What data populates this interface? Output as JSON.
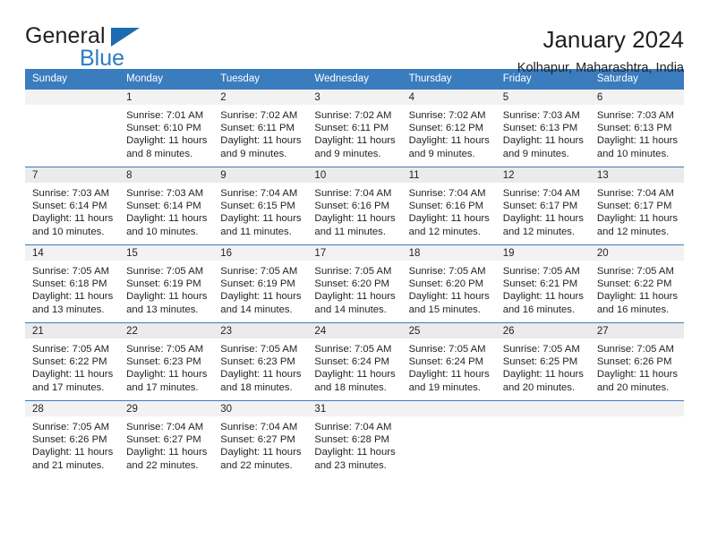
{
  "brand": {
    "word_one": "General",
    "word_two": "Blue",
    "accent_color": "#1b6cb0",
    "blue_text_color": "#2b7cc4"
  },
  "header": {
    "title": "January 2024",
    "subtitle": "Kolhapur, Maharashtra, India"
  },
  "calendar": {
    "header_background": "#3a7cbe",
    "header_text_color": "#ffffff",
    "daynum_band_color": "#f2f2f2",
    "weekday_headers": [
      "Sunday",
      "Monday",
      "Tuesday",
      "Wednesday",
      "Thursday",
      "Friday",
      "Saturday"
    ],
    "labels": {
      "sunrise": "Sunrise:",
      "sunset": "Sunset:",
      "daylight": "Daylight:"
    },
    "weeks": [
      [
        {
          "day": ""
        },
        {
          "day": "1",
          "sunrise": "Sunrise: 7:01 AM",
          "sunset": "Sunset: 6:10 PM",
          "daylight_line1": "Daylight: 11 hours",
          "daylight_line2": "and 8 minutes."
        },
        {
          "day": "2",
          "sunrise": "Sunrise: 7:02 AM",
          "sunset": "Sunset: 6:11 PM",
          "daylight_line1": "Daylight: 11 hours",
          "daylight_line2": "and 9 minutes."
        },
        {
          "day": "3",
          "sunrise": "Sunrise: 7:02 AM",
          "sunset": "Sunset: 6:11 PM",
          "daylight_line1": "Daylight: 11 hours",
          "daylight_line2": "and 9 minutes."
        },
        {
          "day": "4",
          "sunrise": "Sunrise: 7:02 AM",
          "sunset": "Sunset: 6:12 PM",
          "daylight_line1": "Daylight: 11 hours",
          "daylight_line2": "and 9 minutes."
        },
        {
          "day": "5",
          "sunrise": "Sunrise: 7:03 AM",
          "sunset": "Sunset: 6:13 PM",
          "daylight_line1": "Daylight: 11 hours",
          "daylight_line2": "and 9 minutes."
        },
        {
          "day": "6",
          "sunrise": "Sunrise: 7:03 AM",
          "sunset": "Sunset: 6:13 PM",
          "daylight_line1": "Daylight: 11 hours",
          "daylight_line2": "and 10 minutes."
        }
      ],
      [
        {
          "day": "7",
          "sunrise": "Sunrise: 7:03 AM",
          "sunset": "Sunset: 6:14 PM",
          "daylight_line1": "Daylight: 11 hours",
          "daylight_line2": "and 10 minutes."
        },
        {
          "day": "8",
          "sunrise": "Sunrise: 7:03 AM",
          "sunset": "Sunset: 6:14 PM",
          "daylight_line1": "Daylight: 11 hours",
          "daylight_line2": "and 10 minutes."
        },
        {
          "day": "9",
          "sunrise": "Sunrise: 7:04 AM",
          "sunset": "Sunset: 6:15 PM",
          "daylight_line1": "Daylight: 11 hours",
          "daylight_line2": "and 11 minutes."
        },
        {
          "day": "10",
          "sunrise": "Sunrise: 7:04 AM",
          "sunset": "Sunset: 6:16 PM",
          "daylight_line1": "Daylight: 11 hours",
          "daylight_line2": "and 11 minutes."
        },
        {
          "day": "11",
          "sunrise": "Sunrise: 7:04 AM",
          "sunset": "Sunset: 6:16 PM",
          "daylight_line1": "Daylight: 11 hours",
          "daylight_line2": "and 12 minutes."
        },
        {
          "day": "12",
          "sunrise": "Sunrise: 7:04 AM",
          "sunset": "Sunset: 6:17 PM",
          "daylight_line1": "Daylight: 11 hours",
          "daylight_line2": "and 12 minutes."
        },
        {
          "day": "13",
          "sunrise": "Sunrise: 7:04 AM",
          "sunset": "Sunset: 6:17 PM",
          "daylight_line1": "Daylight: 11 hours",
          "daylight_line2": "and 12 minutes."
        }
      ],
      [
        {
          "day": "14",
          "sunrise": "Sunrise: 7:05 AM",
          "sunset": "Sunset: 6:18 PM",
          "daylight_line1": "Daylight: 11 hours",
          "daylight_line2": "and 13 minutes."
        },
        {
          "day": "15",
          "sunrise": "Sunrise: 7:05 AM",
          "sunset": "Sunset: 6:19 PM",
          "daylight_line1": "Daylight: 11 hours",
          "daylight_line2": "and 13 minutes."
        },
        {
          "day": "16",
          "sunrise": "Sunrise: 7:05 AM",
          "sunset": "Sunset: 6:19 PM",
          "daylight_line1": "Daylight: 11 hours",
          "daylight_line2": "and 14 minutes."
        },
        {
          "day": "17",
          "sunrise": "Sunrise: 7:05 AM",
          "sunset": "Sunset: 6:20 PM",
          "daylight_line1": "Daylight: 11 hours",
          "daylight_line2": "and 14 minutes."
        },
        {
          "day": "18",
          "sunrise": "Sunrise: 7:05 AM",
          "sunset": "Sunset: 6:20 PM",
          "daylight_line1": "Daylight: 11 hours",
          "daylight_line2": "and 15 minutes."
        },
        {
          "day": "19",
          "sunrise": "Sunrise: 7:05 AM",
          "sunset": "Sunset: 6:21 PM",
          "daylight_line1": "Daylight: 11 hours",
          "daylight_line2": "and 16 minutes."
        },
        {
          "day": "20",
          "sunrise": "Sunrise: 7:05 AM",
          "sunset": "Sunset: 6:22 PM",
          "daylight_line1": "Daylight: 11 hours",
          "daylight_line2": "and 16 minutes."
        }
      ],
      [
        {
          "day": "21",
          "sunrise": "Sunrise: 7:05 AM",
          "sunset": "Sunset: 6:22 PM",
          "daylight_line1": "Daylight: 11 hours",
          "daylight_line2": "and 17 minutes."
        },
        {
          "day": "22",
          "sunrise": "Sunrise: 7:05 AM",
          "sunset": "Sunset: 6:23 PM",
          "daylight_line1": "Daylight: 11 hours",
          "daylight_line2": "and 17 minutes."
        },
        {
          "day": "23",
          "sunrise": "Sunrise: 7:05 AM",
          "sunset": "Sunset: 6:23 PM",
          "daylight_line1": "Daylight: 11 hours",
          "daylight_line2": "and 18 minutes."
        },
        {
          "day": "24",
          "sunrise": "Sunrise: 7:05 AM",
          "sunset": "Sunset: 6:24 PM",
          "daylight_line1": "Daylight: 11 hours",
          "daylight_line2": "and 18 minutes."
        },
        {
          "day": "25",
          "sunrise": "Sunrise: 7:05 AM",
          "sunset": "Sunset: 6:24 PM",
          "daylight_line1": "Daylight: 11 hours",
          "daylight_line2": "and 19 minutes."
        },
        {
          "day": "26",
          "sunrise": "Sunrise: 7:05 AM",
          "sunset": "Sunset: 6:25 PM",
          "daylight_line1": "Daylight: 11 hours",
          "daylight_line2": "and 20 minutes."
        },
        {
          "day": "27",
          "sunrise": "Sunrise: 7:05 AM",
          "sunset": "Sunset: 6:26 PM",
          "daylight_line1": "Daylight: 11 hours",
          "daylight_line2": "and 20 minutes."
        }
      ],
      [
        {
          "day": "28",
          "sunrise": "Sunrise: 7:05 AM",
          "sunset": "Sunset: 6:26 PM",
          "daylight_line1": "Daylight: 11 hours",
          "daylight_line2": "and 21 minutes."
        },
        {
          "day": "29",
          "sunrise": "Sunrise: 7:04 AM",
          "sunset": "Sunset: 6:27 PM",
          "daylight_line1": "Daylight: 11 hours",
          "daylight_line2": "and 22 minutes."
        },
        {
          "day": "30",
          "sunrise": "Sunrise: 7:04 AM",
          "sunset": "Sunset: 6:27 PM",
          "daylight_line1": "Daylight: 11 hours",
          "daylight_line2": "and 22 minutes."
        },
        {
          "day": "31",
          "sunrise": "Sunrise: 7:04 AM",
          "sunset": "Sunset: 6:28 PM",
          "daylight_line1": "Daylight: 11 hours",
          "daylight_line2": "and 23 minutes."
        },
        {
          "day": ""
        },
        {
          "day": ""
        },
        {
          "day": ""
        }
      ]
    ]
  }
}
